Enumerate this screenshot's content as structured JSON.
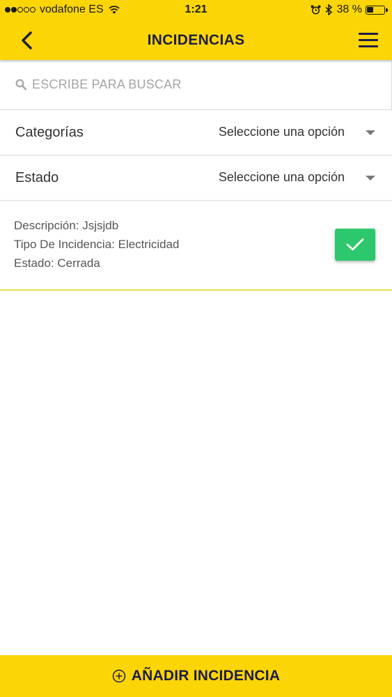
{
  "status_bar": {
    "carrier": "vodafone ES",
    "time": "1:21",
    "battery": "38 %",
    "battery_level": 0.38,
    "signal_bars": 2,
    "signal_total": 5,
    "icons": [
      "wifi-icon",
      "alarm-icon",
      "bluetooth-icon",
      "battery-icon"
    ]
  },
  "header": {
    "title": "INCIDENCIAS",
    "back_icon": "chevron-left-icon",
    "menu_icon": "hamburger-menu-icon"
  },
  "search": {
    "placeholder": "ESCRIBE PARA BUSCAR",
    "value": "",
    "icon": "search-icon"
  },
  "filters": [
    {
      "label": "Categorías",
      "value": "Seleccione una opción"
    },
    {
      "label": "Estado",
      "value": "Seleccione una opción"
    }
  ],
  "incidencias": [
    {
      "descripcion": "Descripción: Jsjsjdb",
      "tipo": "Tipo De Incidencia: Electricidad",
      "estado": "Estado: Cerrada",
      "status_icon": "checkmark-icon",
      "status_color": "#2dc76d"
    }
  ],
  "footer": {
    "add_label": "AÑADIR INCIDENCIA",
    "add_icon": "plus-circle-icon"
  },
  "colors": {
    "brand_yellow": "#fcd506",
    "title_navy": "#1e1d45",
    "success_green": "#2dc76d",
    "divider_yellow": "#e6e24a"
  }
}
